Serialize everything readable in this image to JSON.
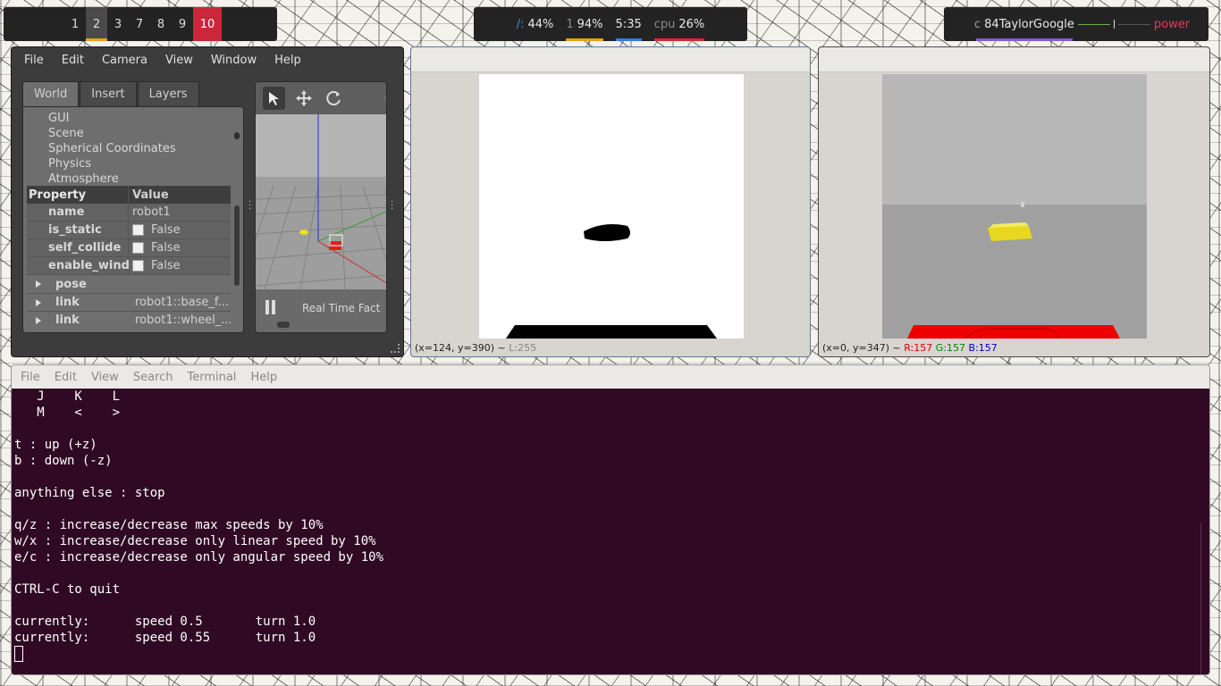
{
  "topbar": {
    "workspaces": [
      {
        "label": "1",
        "state": "normal"
      },
      {
        "label": "2",
        "state": "active"
      },
      {
        "label": "3",
        "state": "normal"
      },
      {
        "label": "7",
        "state": "normal"
      },
      {
        "label": "8",
        "state": "normal"
      },
      {
        "label": "9",
        "state": "normal"
      },
      {
        "label": "10",
        "state": "urgent"
      }
    ],
    "stats": {
      "disk_label": "/:",
      "disk_value": "44%",
      "battery_label": "1",
      "battery_value": "94%",
      "clock": "5:35",
      "cpu_label": "cpu",
      "cpu_value": "26%"
    },
    "system": {
      "prefix": "c",
      "user": "84TaylorGoogle",
      "power": "power"
    },
    "colors": {
      "accent_yellow": "#e8a11f",
      "accent_blue": "#2f7de0",
      "accent_red": "#d8283a",
      "urgent": "#c8283a",
      "power": "#e03a5a"
    }
  },
  "gazebo": {
    "menu": [
      "File",
      "Edit",
      "Camera",
      "View",
      "Window",
      "Help"
    ],
    "tabs": [
      "World",
      "Insert",
      "Layers"
    ],
    "tree_items": [
      "GUI",
      "Scene",
      "Spherical Coordinates",
      "Physics",
      "Atmosphere"
    ],
    "props_header": {
      "key": "Property",
      "value": "Value"
    },
    "props": [
      {
        "key": "name",
        "value": "robot1"
      },
      {
        "key": "is_static",
        "value": "False"
      },
      {
        "key": "self_collide",
        "value": "False"
      },
      {
        "key": "enable_wind",
        "value": "False"
      }
    ],
    "expandables": [
      {
        "key": "pose",
        "value": ""
      },
      {
        "key": "link",
        "value": "robot1::base_f..."
      },
      {
        "key": "link",
        "value": "robot1::wheel_..."
      }
    ],
    "render": {
      "rtf_label": "Real Time Fact"
    }
  },
  "viewer1": {
    "status_coords": "(x=124, y=390) ~",
    "status_value": "L:255"
  },
  "viewer2": {
    "status_coords": "(x=0, y=347) ~",
    "r": "R:157",
    "g": "G:157",
    "b": "B:157"
  },
  "terminal": {
    "menu": [
      "File",
      "Edit",
      "View",
      "Search",
      "Terminal",
      "Help"
    ],
    "lines": [
      "   J    K    L",
      "   M    <    >",
      "",
      "t : up (+z)",
      "b : down (-z)",
      "",
      "anything else : stop",
      "",
      "q/z : increase/decrease max speeds by 10%",
      "w/x : increase/decrease only linear speed by 10%",
      "e/c : increase/decrease only angular speed by 10%",
      "",
      "CTRL-C to quit",
      "",
      "currently:\tspeed 0.5\tturn 1.0 ",
      "currently:\tspeed 0.55\tturn 1.0 "
    ]
  }
}
